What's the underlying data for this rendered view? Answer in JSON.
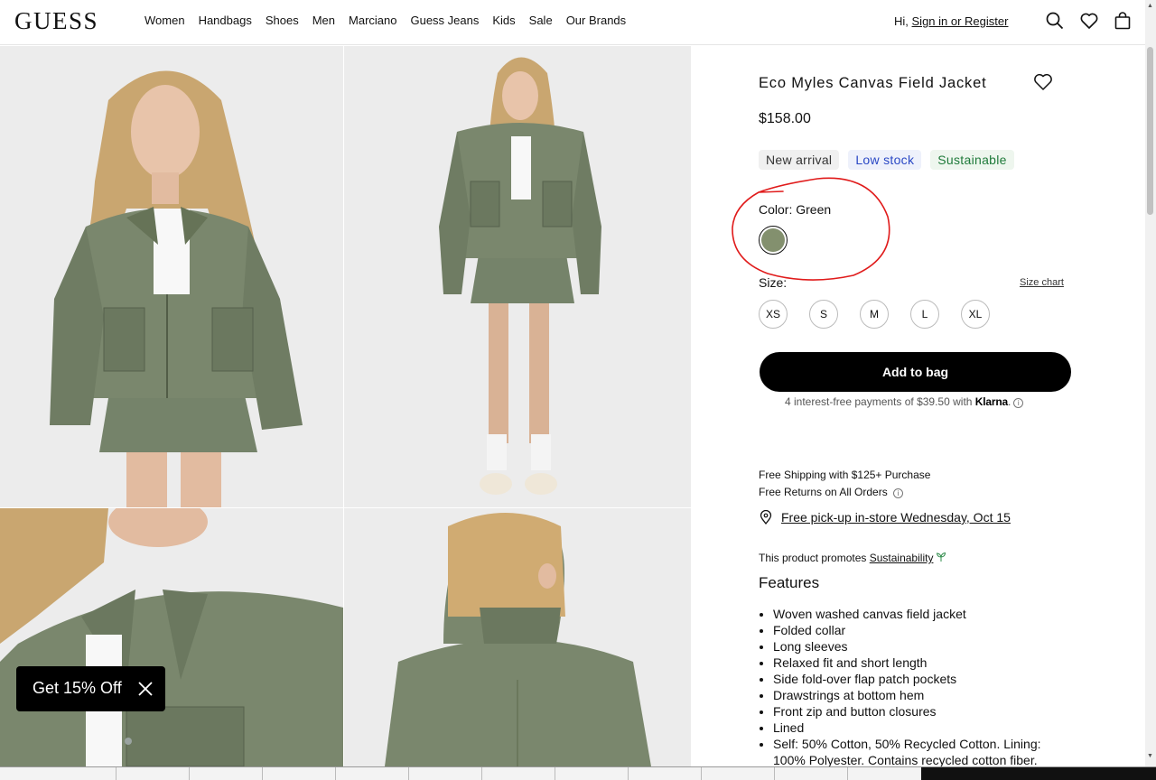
{
  "header": {
    "logo": "GUESS",
    "nav": [
      "Women",
      "Handbags",
      "Shoes",
      "Men",
      "Marciano",
      "Guess Jeans",
      "Kids",
      "Sale",
      "Our Brands"
    ],
    "greeting": "Hi,",
    "signin": "Sign in or Register"
  },
  "product": {
    "title": "Eco Myles Canvas Field Jacket",
    "price": "$158.00",
    "badges": [
      "New arrival",
      "Low stock",
      "Sustainable"
    ],
    "color_label": "Color: Green",
    "swatch_color": "#83906e",
    "size_label": "Size:",
    "size_chart": "Size chart",
    "sizes": [
      "XS",
      "S",
      "M",
      "L",
      "XL"
    ],
    "add_to_bag": "Add to bag",
    "klarna_text": "4 interest-free payments of $39.50 with",
    "klarna_brand": "Klarna",
    "shipping": "Free Shipping with $125+ Purchase",
    "returns": "Free Returns on All Orders",
    "pickup": "Free pick-up in-store Wednesday, Oct 15",
    "promotes_prefix": "This product promotes",
    "promotes_link": "Sustainability",
    "features_title": "Features",
    "features": [
      "Woven washed canvas field jacket",
      "Folded collar",
      "Long sleeves",
      "Relaxed fit and short length",
      "Side fold-over flap patch pockets",
      "Drawstrings at bottom hem",
      "Front zip and button closures",
      "Lined",
      "Self: 50% Cotton, 50% Recycled Cotton. Lining: 100% Polyester. Contains recycled cotton fiber."
    ]
  },
  "promo": {
    "text": "Get 15% Off"
  },
  "colors": {
    "jacket_green": "#75836a",
    "photo_bg": "#ececec",
    "annotation_red": "#e01b1b"
  }
}
